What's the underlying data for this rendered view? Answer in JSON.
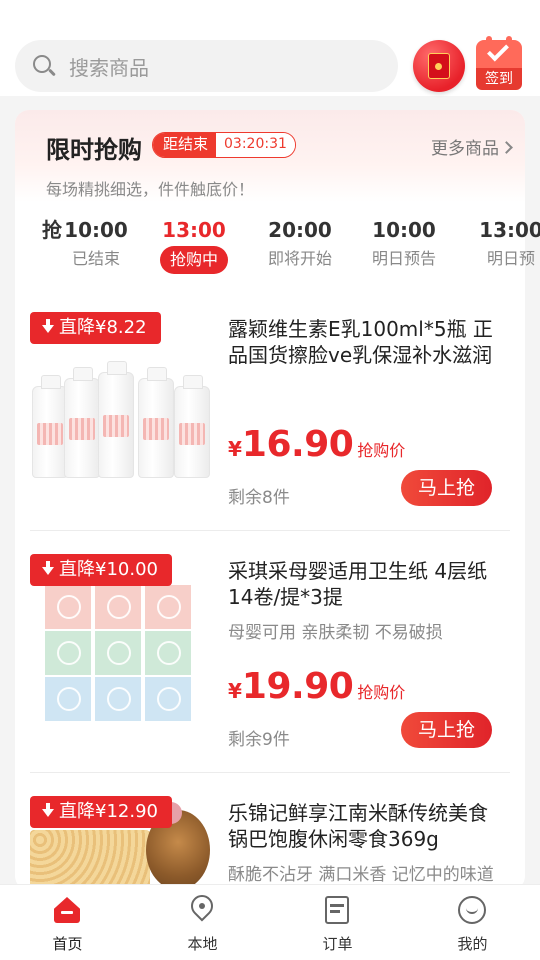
{
  "search": {
    "placeholder": "搜索商品"
  },
  "header": {
    "signin_label": "签到"
  },
  "flash_sale": {
    "title": "限时抢购",
    "countdown_label": "距结束",
    "countdown_time": "03:20:31",
    "more_label": "更多商品",
    "subtitle": "每场精挑细选，件件触底价！"
  },
  "time_tabs": [
    {
      "time": "抢",
      "status": ""
    },
    {
      "time": "10:00",
      "status": "已结束"
    },
    {
      "time": "13:00",
      "status": "抢购中",
      "active": true
    },
    {
      "time": "20:00",
      "status": "即将开始"
    },
    {
      "time": "10:00",
      "status": "明日预告"
    },
    {
      "time": "13:00",
      "status": "明日预"
    }
  ],
  "products": [
    {
      "badge": "直降¥8.22",
      "name": "露颖维生素E乳100ml*5瓶 正品国货擦脸ve乳保湿补水滋润",
      "tags": "",
      "currency": "¥",
      "price": "16.90",
      "price_tag": "抢购价",
      "stock": "剩余8件",
      "buy_label": "马上抢"
    },
    {
      "badge": "直降¥10.00",
      "name": "采琪采母婴适用卫生纸 4层纸14卷/提*3提",
      "tags": "母婴可用  亲肤柔韧  不易破损",
      "currency": "¥",
      "price": "19.90",
      "price_tag": "抢购价",
      "stock": "剩余9件",
      "buy_label": "马上抢"
    },
    {
      "badge": "直降¥12.90",
      "name": "乐锦记鲜享江南米酥传统美食锅巴饱腹休闲零食369g",
      "tags": "酥脆不沾牙  满口米香  记忆中的味道"
    }
  ],
  "nav": [
    {
      "label": "首页",
      "icon": "home-icon",
      "active": true
    },
    {
      "label": "本地",
      "icon": "location-pin-icon"
    },
    {
      "label": "订单",
      "icon": "order-icon"
    },
    {
      "label": "我的",
      "icon": "profile-icon"
    }
  ],
  "colors": {
    "accent": "#e8282b",
    "background": "#f4f4f4"
  }
}
